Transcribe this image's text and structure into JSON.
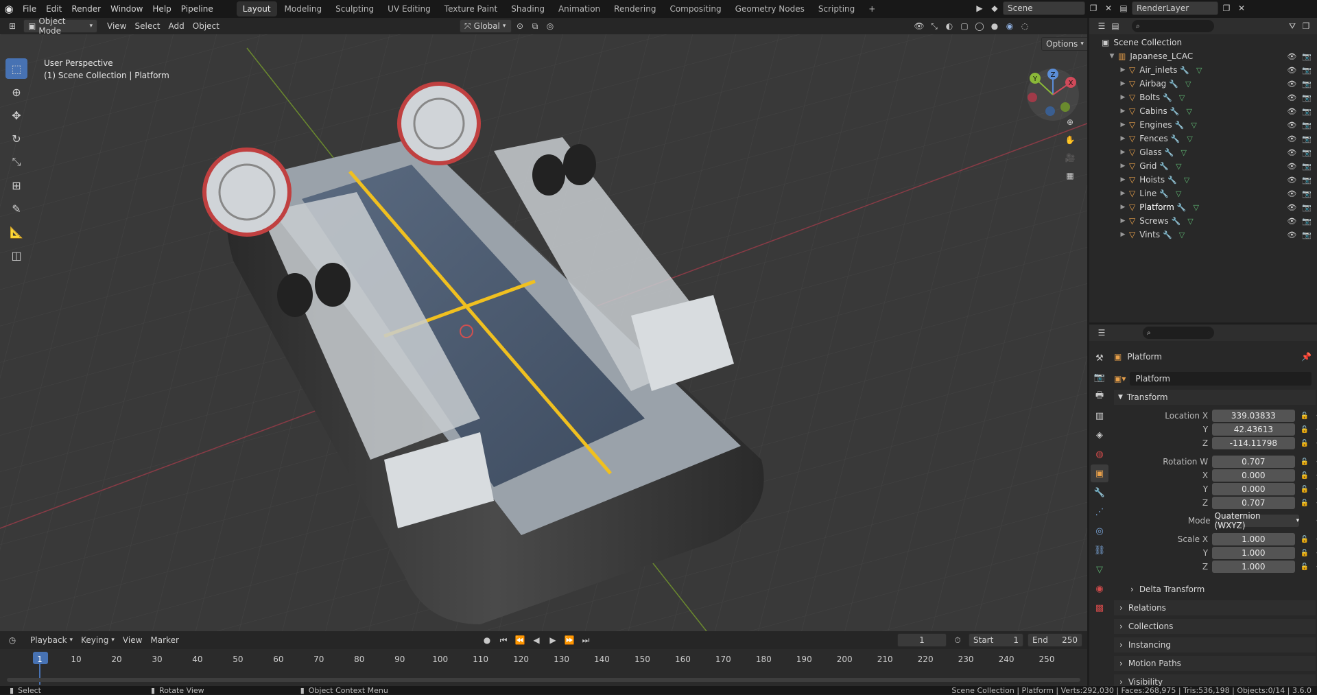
{
  "topbar": {
    "menus": [
      "File",
      "Edit",
      "Render",
      "Window",
      "Help",
      "Pipeline"
    ],
    "workspaces": [
      "Layout",
      "Modeling",
      "Sculpting",
      "UV Editing",
      "Texture Paint",
      "Shading",
      "Animation",
      "Rendering",
      "Compositing",
      "Geometry Nodes",
      "Scripting"
    ],
    "active_workspace": "Layout",
    "add_tab": "+",
    "scene_name": "Scene",
    "render_layer": "RenderLayer"
  },
  "viewport_header": {
    "mode": "Object Mode",
    "menus": [
      "View",
      "Select",
      "Add",
      "Object"
    ],
    "orientation": "Global",
    "options_label": "Options"
  },
  "viewport": {
    "perspective_label": "User Perspective",
    "collection_label": "(1) Scene Collection | Platform",
    "gizmo_axes": {
      "z": "Z",
      "y": "Y",
      "x": "X"
    },
    "colors": {
      "x_axis": "#c04a5a",
      "y_axis": "#8ab838",
      "deck_line": "#f0c020"
    }
  },
  "outliner": {
    "root": "Scene Collection",
    "collection": "Japanese_LCAC",
    "items": [
      "Air_inlets",
      "Airbag",
      "Bolts",
      "Cabins",
      "Engines",
      "Fences",
      "Glass",
      "Grid",
      "Hoists",
      "Line",
      "Platform",
      "Screws",
      "Vints"
    ],
    "active_item": "Platform"
  },
  "properties": {
    "object_name": "Platform",
    "data_name": "Platform",
    "transform_header": "Transform",
    "location": {
      "label_x": "Location X",
      "label_y": "Y",
      "label_z": "Z",
      "x": "339.03833",
      "y": "42.43613",
      "z": "-114.11798"
    },
    "rotation": {
      "label_w": "Rotation W",
      "label_x": "X",
      "label_y": "Y",
      "label_z": "Z",
      "w": "0.707",
      "x": "0.000",
      "y": "0.000",
      "z": "0.707"
    },
    "mode": {
      "label": "Mode",
      "value": "Quaternion (WXYZ)"
    },
    "scale": {
      "label_x": "Scale X",
      "label_y": "Y",
      "label_z": "Z",
      "x": "1.000",
      "y": "1.000",
      "z": "1.000"
    },
    "panels": [
      "Delta Transform",
      "Relations",
      "Collections",
      "Instancing",
      "Motion Paths",
      "Visibility"
    ]
  },
  "timeline": {
    "menus": [
      "Playback",
      "Keying",
      "View",
      "Marker"
    ],
    "current_frame": "1",
    "start_label": "Start",
    "start": "1",
    "end_label": "End",
    "end": "250",
    "ticks": [
      "1",
      "10",
      "20",
      "30",
      "40",
      "50",
      "60",
      "70",
      "80",
      "90",
      "100",
      "110",
      "120",
      "130",
      "140",
      "150",
      "160",
      "170",
      "180",
      "190",
      "200",
      "210",
      "220",
      "230",
      "240",
      "250"
    ]
  },
  "statusbar": {
    "select": "Select",
    "rotate": "Rotate View",
    "context": "Object Context Menu",
    "stats": "Scene Collection | Platform | Verts:292,030 | Faces:268,975 | Tris:536,198 | Objects:0/14 | 3.6.0"
  }
}
